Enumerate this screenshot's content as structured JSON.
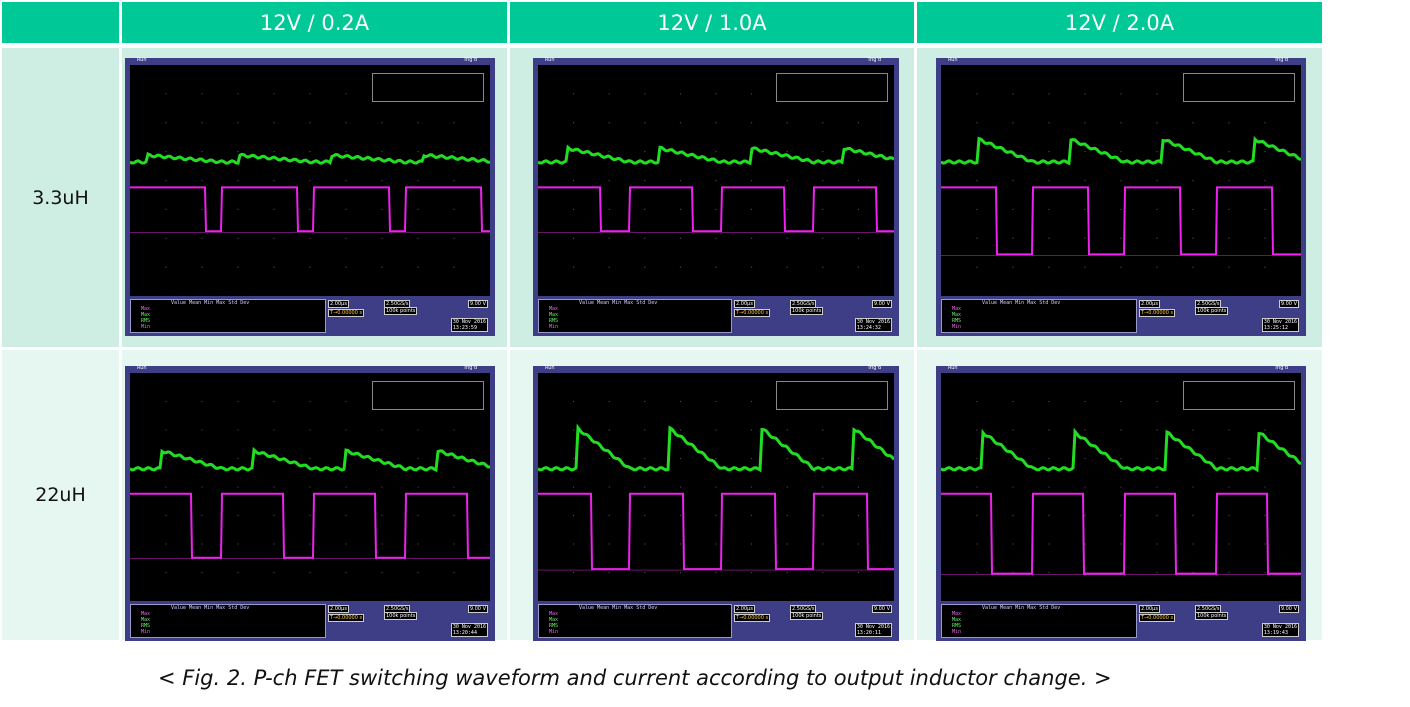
{
  "headers": [
    "12V / 0.2A",
    "12V / 1.0A",
    "12V / 2.0A"
  ],
  "rows": [
    "3.3uH",
    "22uH"
  ],
  "caption": "< Fig. 2. P-ch FET switching waveform and current according to output inductor change. >",
  "colors": {
    "header_bg": "#00c896",
    "row_bg_1": "#cfeee3",
    "row_bg_2": "#e6f6f0",
    "scope_frame": "#3e3e86",
    "trace_green": "#22dd22",
    "trace_magenta": "#ee22ee"
  },
  "scope": {
    "run_label": "Run",
    "trig_label": "Trig'd",
    "timebase": "2.00µs",
    "trigger_pos": "T→0.00000 s",
    "sample_rate": "2.50GS/s",
    "record_length": "100k points",
    "trigger_level": "9.00 V",
    "stat_header": "Value   Mean    Min     Max    Std Dev",
    "stat_labels": [
      "Max",
      "Max",
      "RMS",
      "Min"
    ]
  },
  "screens": [
    {
      "date": "30 Nov 2016",
      "time": "13:23:59"
    },
    {
      "date": "30 Nov 2016",
      "time": "13:24:32"
    },
    {
      "date": "30 Nov 2016",
      "time": "13:25:12"
    },
    {
      "date": "30 Nov 2016",
      "time": "13:20:44"
    },
    {
      "date": "30 Nov 2016",
      "time": "13:20:11"
    },
    {
      "date": "30 Nov 2016",
      "time": "13:19:43"
    }
  ]
}
